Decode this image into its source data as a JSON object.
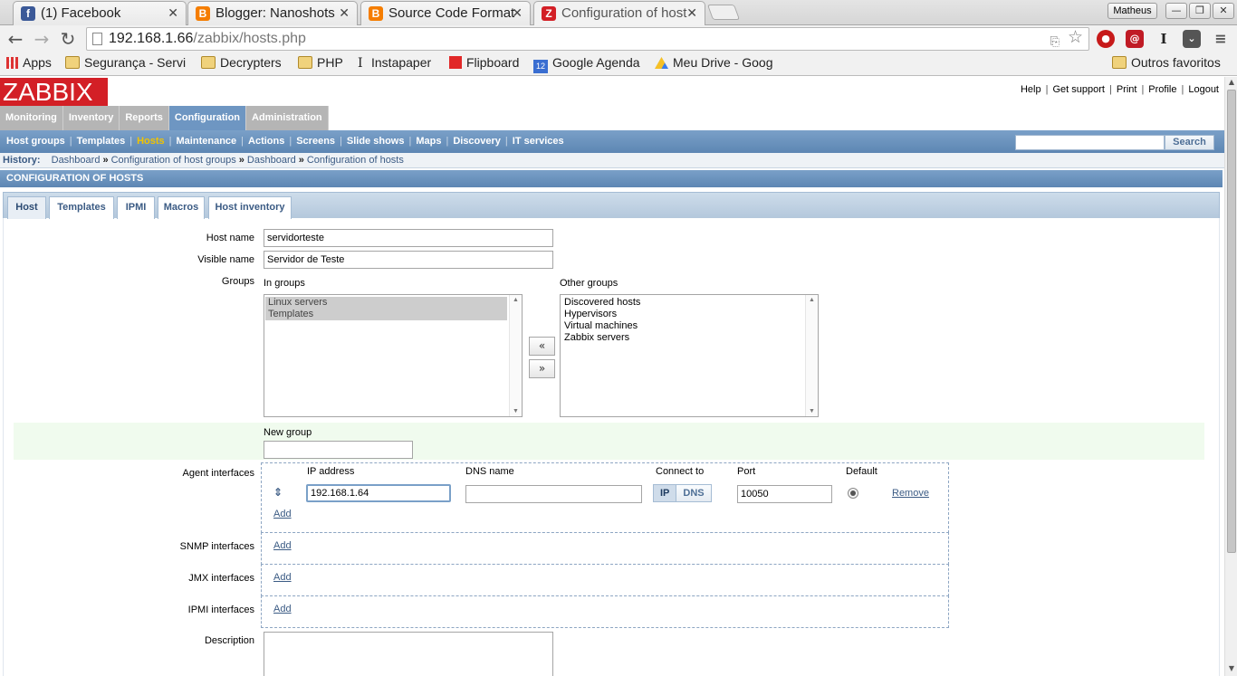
{
  "browser": {
    "tabs": [
      {
        "title": "(1) Facebook",
        "icon": "facebook-icon",
        "color": "#3b5998",
        "glyph": "f"
      },
      {
        "title": "Blogger: Nanoshots",
        "icon": "blogger-icon",
        "color": "#f57d00",
        "glyph": "B"
      },
      {
        "title": "Source Code Format",
        "icon": "blogger-icon",
        "color": "#f57d00",
        "glyph": "B"
      },
      {
        "title": "Configuration of host",
        "icon": "zabbix-icon",
        "color": "#d31f26",
        "glyph": "Z"
      }
    ],
    "profile": "Matheus",
    "url_host": "192.168.1.66",
    "url_path": "/zabbix/hosts.php",
    "bookmarks": [
      {
        "label": "Apps",
        "icon": "apps-grid-icon"
      },
      {
        "label": "Segurança - Servi",
        "icon": "folder-icon"
      },
      {
        "label": "Decrypters",
        "icon": "folder-icon"
      },
      {
        "label": "PHP",
        "icon": "folder-icon"
      },
      {
        "label": "Instapaper",
        "icon": "instapaper-icon"
      },
      {
        "label": "Flipboard",
        "icon": "flipboard-icon"
      },
      {
        "label": "Google Agenda",
        "icon": "calendar-icon"
      },
      {
        "label": "Meu Drive - Goog",
        "icon": "drive-icon"
      }
    ],
    "other_bookmarks": "Outros favoritos",
    "calendar_day": "12"
  },
  "zabbix": {
    "logo": "ZABBIX",
    "top_links": [
      "Help",
      "Get support",
      "Print",
      "Profile",
      "Logout"
    ],
    "main_menu": [
      "Monitoring",
      "Inventory",
      "Reports",
      "Configuration",
      "Administration"
    ],
    "sub_menu": [
      "Host groups",
      "Templates",
      "Hosts",
      "Maintenance",
      "Actions",
      "Screens",
      "Slide shows",
      "Maps",
      "Discovery",
      "IT services"
    ],
    "search_button": "Search",
    "history_label": "History:",
    "history": [
      "Dashboard",
      "Configuration of host groups",
      "Dashboard",
      "Configuration of hosts"
    ],
    "raquo": "»",
    "section_title": "CONFIGURATION OF HOSTS",
    "form_tabs": [
      "Host",
      "Templates",
      "IPMI",
      "Macros",
      "Host inventory"
    ],
    "form": {
      "host_name_label": "Host name",
      "host_name": "servidorteste",
      "visible_name_label": "Visible name",
      "visible_name": "Servidor de Teste",
      "groups_label": "Groups",
      "in_groups_label": "In groups",
      "in_groups": [
        "Linux servers",
        "Templates"
      ],
      "other_groups_label": "Other groups",
      "other_groups": [
        "Discovered hosts",
        "Hypervisors",
        "Virtual machines",
        "Zabbix servers"
      ],
      "move_left": "«",
      "move_right": "»",
      "new_group_label": "New group",
      "new_group_value": "",
      "agent_interfaces_label": "Agent interfaces",
      "col_ip": "IP address",
      "col_dns": "DNS name",
      "col_connect": "Connect to",
      "col_port": "Port",
      "col_default": "Default",
      "ip_value": "192.168.1.64",
      "dns_value": "",
      "connect_ip": "IP",
      "connect_dns": "DNS",
      "port_value": "10050",
      "remove": "Remove",
      "add": "Add",
      "snmp_label": "SNMP interfaces",
      "jmx_label": "JMX interfaces",
      "ipmi_label": "IPMI interfaces",
      "description_label": "Description",
      "description_value": ""
    }
  }
}
